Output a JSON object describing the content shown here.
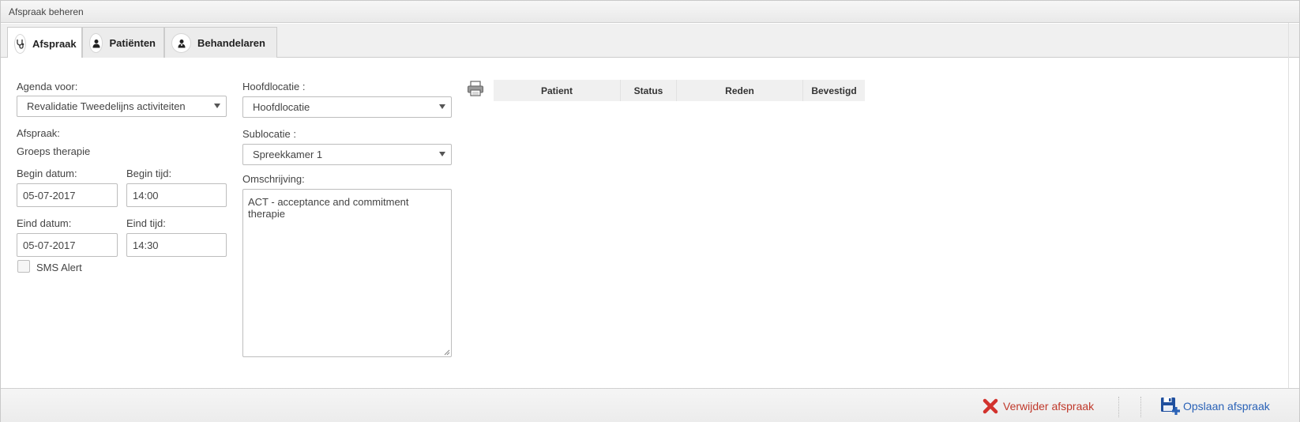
{
  "window": {
    "title": "Afspraak beheren"
  },
  "tabs": [
    {
      "label": "Afspraak",
      "icon": "stethoscope-icon",
      "active": true
    },
    {
      "label": "Patiënten",
      "icon": "user-icon",
      "active": false
    },
    {
      "label": "Behandelaren",
      "icon": "doctor-icon",
      "active": false
    }
  ],
  "form": {
    "agenda_label": "Agenda voor:",
    "agenda_value": "Revalidatie Tweedelijns activiteiten",
    "afspraak_label": "Afspraak:",
    "afspraak_value": "Groeps therapie",
    "begin_datum_label": "Begin datum:",
    "begin_datum_value": "05-07-2017",
    "begin_tijd_label": "Begin tijd:",
    "begin_tijd_value": "14:00",
    "eind_datum_label": "Eind datum:",
    "eind_datum_value": "05-07-2017",
    "eind_tijd_label": "Eind tijd:",
    "eind_tijd_value": "14:30",
    "sms_label": "SMS Alert",
    "sms_checked": false,
    "hoofdlocatie_label": "Hoofdlocatie :",
    "hoofdlocatie_value": "Hoofdlocatie",
    "sublocatie_label": "Sublocatie :",
    "sublocatie_value": "Spreekkamer 1",
    "omschrijving_label": "Omschrijving:",
    "omschrijving_value": "ACT - acceptance and commitment therapie"
  },
  "grid": {
    "columns": [
      "Patient",
      "Status",
      "Reden",
      "Bevestigd"
    ],
    "rows": []
  },
  "footer": {
    "delete_label": "Verwijder afspraak",
    "save_label": "Opslaan afspraak"
  },
  "colors": {
    "delete": "#c0392b",
    "save": "#2a62b7"
  }
}
